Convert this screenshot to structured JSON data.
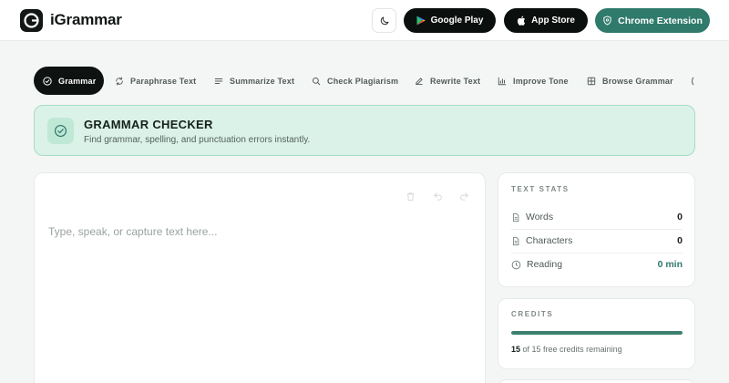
{
  "header": {
    "brand": "iGrammar",
    "google_play": "Google Play",
    "app_store": "App Store",
    "chrome_extension": "Chrome Extension"
  },
  "tabs": [
    {
      "label": "Grammar",
      "icon": "check-circle-icon",
      "active": true
    },
    {
      "label": "Paraphrase Text",
      "icon": "refresh-icon"
    },
    {
      "label": "Summarize Text",
      "icon": "lines-icon"
    },
    {
      "label": "Check Plagiarism",
      "icon": "search-icon"
    },
    {
      "label": "Rewrite Text",
      "icon": "pencil-icon"
    },
    {
      "label": "Improve Tone",
      "icon": "bar-chart-icon"
    },
    {
      "label": "Browse Grammar",
      "icon": "grid-icon"
    }
  ],
  "banner": {
    "title": "GRAMMAR CHECKER",
    "subtitle": "Find grammar, spelling, and punctuation errors instantly."
  },
  "editor": {
    "placeholder": "Type, speak, or capture text here..."
  },
  "stats": {
    "title": "TEXT STATS",
    "rows": [
      {
        "label": "Words",
        "value": "0"
      },
      {
        "label": "Characters",
        "value": "0"
      },
      {
        "label": "Reading",
        "value": "0 min"
      }
    ]
  },
  "credits": {
    "title": "CREDITS",
    "remaining": "15",
    "text": "of 15 free credits remaining",
    "fraction": 1.0
  },
  "colors": {
    "accent": "#2f7a6b",
    "banner_bg": "#dbf2e8",
    "dark": "#0e1210"
  }
}
